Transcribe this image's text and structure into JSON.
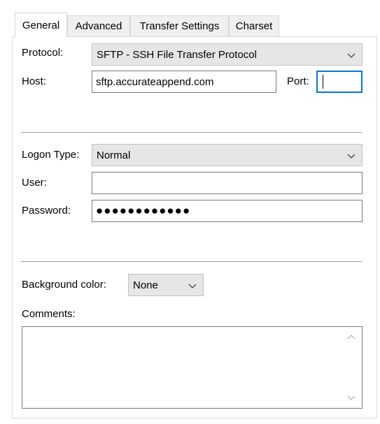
{
  "tabs": [
    {
      "label": "General",
      "active": true
    },
    {
      "label": "Advanced",
      "active": false
    },
    {
      "label": "Transfer Settings",
      "active": false
    },
    {
      "label": "Charset",
      "active": false
    }
  ],
  "general": {
    "protocol": {
      "label": "Protocol:",
      "value": "SFTP - SSH File Transfer Protocol"
    },
    "host": {
      "label": "Host:",
      "value": "sftp.accurateappend.com"
    },
    "port": {
      "label": "Port:",
      "value": ""
    },
    "logon_type": {
      "label": "Logon Type:",
      "value": "Normal"
    },
    "user": {
      "label": "User:",
      "value": ""
    },
    "password": {
      "label": "Password:",
      "value": "●●●●●●●●●●●●"
    },
    "background_color": {
      "label": "Background color:",
      "value": "None"
    },
    "comments": {
      "label": "Comments:",
      "value": ""
    }
  },
  "icons": {
    "dropdown": "chevron-down-icon",
    "scroll_up": "scroll-up-arrow-icon",
    "scroll_down": "scroll-down-arrow-icon"
  }
}
